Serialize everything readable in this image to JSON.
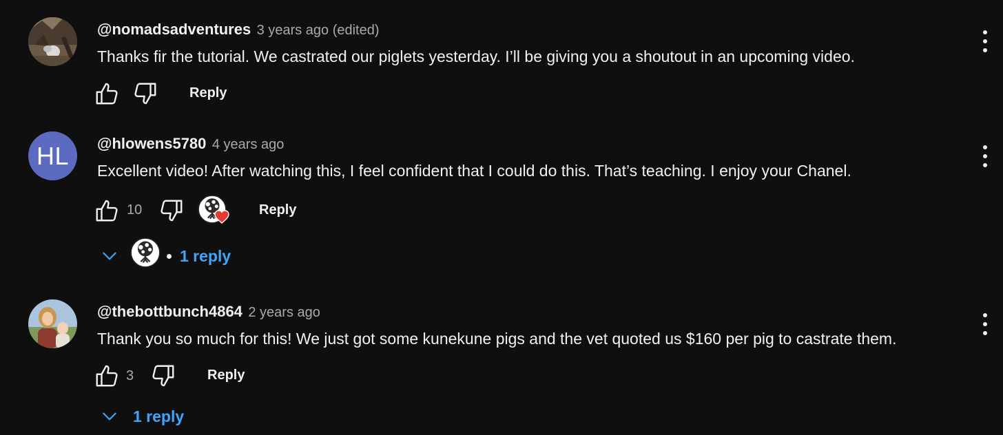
{
  "colors": {
    "background": "#0f0f0f",
    "text_primary": "#f1f1f1",
    "text_secondary": "#aaaaaa",
    "link_blue": "#3ea6ff",
    "avatar_initials_bg": "#5c6bc0",
    "heart_red": "#e53935"
  },
  "comments": [
    {
      "author": "@nomadsadventures",
      "meta": "3 years ago (edited)",
      "text": "Thanks fir the tutorial. We castrated our piglets yesterday. I’ll be giving you a shoutout in an upcoming video.",
      "likes": "",
      "reply_label": "Reply",
      "avatar": "photo-avatar-outdoor"
    },
    {
      "author": "@hlowens5780",
      "meta": "4 years ago",
      "text": "Excellent video! After watching this, I feel confident that I could do this. That’s teaching. I enjoy your Chanel.",
      "likes": "10",
      "reply_label": "Reply",
      "avatar_initials": "HL",
      "creator_heart": true,
      "replies_label": "1 reply"
    },
    {
      "author": "@thebottbunch4864",
      "meta": "2 years ago",
      "text": "Thank you so much for this! We just got some kunekune pigs and the vet quoted us $160 per pig to castrate them.",
      "likes": "3",
      "reply_label": "Reply",
      "avatar": "photo-avatar-family",
      "replies_label": "1 reply"
    }
  ],
  "icons": {
    "like": "thumbs-up-icon",
    "dislike": "thumbs-down-icon",
    "more": "more-vertical-icon",
    "expand": "chevron-down-icon",
    "heart": "heart-icon",
    "creator_avatar": "tree-of-life-icon"
  }
}
